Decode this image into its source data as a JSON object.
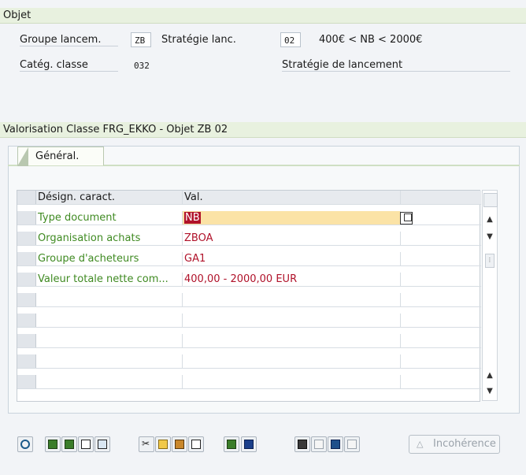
{
  "object_section": {
    "title": "Objet",
    "fields": {
      "group_label": "Groupe lancem.",
      "group_value": "ZB",
      "strategy_label": "Stratégie lanc.",
      "strategy_value": "02",
      "strategy_desc": "400€ < NB < 2000€",
      "class_label": "Catég. classe",
      "class_value": "032",
      "strategy_title": "Stratégie de lancement"
    }
  },
  "valuation_section": {
    "title": "Valorisation Classe FRG_EKKO - Objet ZB 02",
    "tab_label": "Général."
  },
  "grid": {
    "headers": [
      "Désign. caract.",
      "Val."
    ],
    "rows": [
      {
        "name": "Type document",
        "value": "NB"
      },
      {
        "name": "Organisation achats",
        "value": "ZBOA"
      },
      {
        "name": "Groupe d'acheteurs",
        "value": "GA1"
      },
      {
        "name": "Valeur totale nette com...",
        "value": "400,00 - 2000,00 EUR"
      },
      {
        "name": "",
        "value": ""
      },
      {
        "name": "",
        "value": ""
      },
      {
        "name": "",
        "value": ""
      },
      {
        "name": "",
        "value": ""
      },
      {
        "name": "",
        "value": ""
      },
      {
        "name": "",
        "value": ""
      }
    ]
  },
  "toolbar": {
    "incoherence_label": "Incohérence",
    "icons": [
      "zoom-icon",
      "first-page-icon",
      "prev-page-icon",
      "print-icon",
      "filter-icon",
      "cut-icon",
      "copy-icon",
      "paste-icon",
      "delete-icon",
      "insert-row-icon",
      "info-icon",
      "binoculars-icon",
      "restore-icon",
      "table-icon",
      "chart-icon"
    ]
  },
  "colors": {
    "header_bg": "#e8f1df",
    "selected_cell": "#fbe3a6",
    "value_red": "#b0122a",
    "label_green": "#3f8a22"
  }
}
